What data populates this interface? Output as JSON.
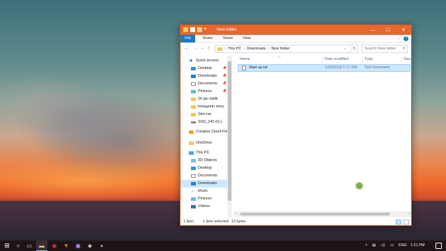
{
  "window": {
    "title": "New folder",
    "accent_color": "#e7672f",
    "controls": {
      "minimize": "—",
      "maximize": "☐",
      "close": "✕"
    }
  },
  "ribbon": {
    "tabs": [
      {
        "label": "File"
      },
      {
        "label": "Home"
      },
      {
        "label": "Share"
      },
      {
        "label": "View"
      }
    ],
    "help": "?"
  },
  "navigation": {
    "back": "←",
    "forward": "→",
    "recent": "⌄",
    "up": "↑",
    "breadcrumb": [
      "This PC",
      "Downloads",
      "New folder"
    ],
    "search_placeholder": "Search New folder"
  },
  "nav_pane": {
    "items": [
      {
        "label": "Quick access",
        "icon": "star-icon"
      },
      {
        "label": "Desktop",
        "icon": "desktop-icon",
        "pinned": true
      },
      {
        "label": "Downloads",
        "icon": "downloads-icon",
        "pinned": true
      },
      {
        "label": "Documents",
        "icon": "documents-icon",
        "pinned": true
      },
      {
        "label": "Pictures",
        "icon": "pictures-icon",
        "pinned": true
      },
      {
        "label": "26 jan inklik",
        "icon": "folder-icon"
      },
      {
        "label": "instagram story",
        "icon": "folder-icon"
      },
      {
        "label": "Skin ive",
        "icon": "folder-icon"
      },
      {
        "label": "SSD_240 (G:)",
        "icon": "drive-icon"
      },
      {
        "label": "Creative Cloud Files",
        "icon": "creative-cloud-icon"
      },
      {
        "label": "OneDrive",
        "icon": "onedrive-icon"
      },
      {
        "label": "This PC",
        "icon": "computer-icon"
      },
      {
        "label": "3D Objects",
        "icon": "3d-objects-icon"
      },
      {
        "label": "Desktop",
        "icon": "desktop-icon"
      },
      {
        "label": "Documents",
        "icon": "documents-icon"
      },
      {
        "label": "Downloads",
        "icon": "downloads-icon",
        "selected": true
      },
      {
        "label": "Music",
        "icon": "music-icon"
      },
      {
        "label": "Pictures",
        "icon": "pictures-icon"
      },
      {
        "label": "Videos",
        "icon": "videos-icon"
      }
    ]
  },
  "file_list": {
    "columns": [
      "Name",
      "Date modified",
      "Type",
      "Size"
    ],
    "rows": [
      {
        "name": "Start up.txt",
        "date": "1/29/2018 1:17 PM",
        "type": "Text Document"
      }
    ]
  },
  "status": {
    "count": "1 item",
    "selection": "1 item selected",
    "size": "13 bytes"
  },
  "taskbar": {
    "tray_language": "ENG",
    "clock": "1:21 PM"
  }
}
